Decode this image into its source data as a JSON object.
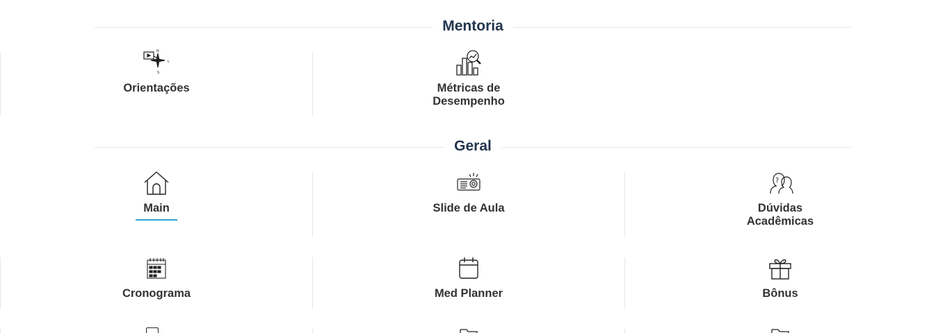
{
  "sections": [
    {
      "title": "Mentoria",
      "items": [
        {
          "label": "Orientações",
          "icon": "compass-icon"
        },
        {
          "label": "Métricas de\nDesempenho",
          "icon": "metrics-chart-icon"
        }
      ]
    },
    {
      "title": "Geral",
      "items": [
        {
          "label": "Main",
          "icon": "home-icon",
          "active": true
        },
        {
          "label": "Slide de Aula",
          "icon": "projector-icon"
        },
        {
          "label": "Dúvidas\nAcadêmicas",
          "icon": "question-people-icon"
        },
        {
          "label": "Cronograma",
          "icon": "calendar-grid-icon"
        },
        {
          "label": "Med Planner",
          "icon": "calendar-icon"
        },
        {
          "label": "Bônus",
          "icon": "gift-icon"
        }
      ]
    }
  ],
  "colors": {
    "heading": "#23354d",
    "accent": "#2fa4d6",
    "text": "#333333",
    "divider": "#e6e6e6"
  }
}
